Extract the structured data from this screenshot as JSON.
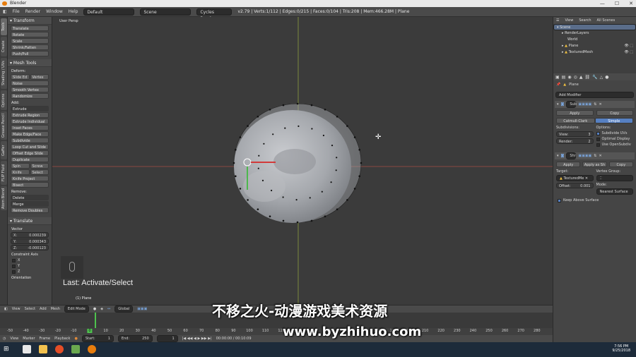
{
  "window": {
    "title": "Blender",
    "controls": [
      "—",
      "☐",
      "✕"
    ]
  },
  "menubar": {
    "menus": [
      "File",
      "Render",
      "Window",
      "Help"
    ],
    "screen_layout": "Default",
    "scene": "Scene",
    "engine": "Cycles Render",
    "stats": "v2.79 | Verts:1/112 | Edges:0/215 | Faces:0/104 | Tris:208 | Mem:466.28M | Plane"
  },
  "vertical_tabs": [
    "Tools",
    "Create",
    "Shading / UVs",
    "Options",
    "Grease Pencil",
    "Gaffer",
    "FLIP Fluid",
    "Atom Blend"
  ],
  "toolshelf": {
    "transform_header": "Transform",
    "transform_buttons": [
      "Translate",
      "Rotate",
      "Scale",
      "Shrink/Fatten",
      "Push/Pull"
    ],
    "mesh_tools_header": "Mesh Tools",
    "deform_label": "Deform:",
    "slide_edge": "Slide Ed",
    "vertex": "Vertex",
    "deform_buttons": [
      "Noise",
      "Smooth Vertex",
      "Randomize"
    ],
    "add_label": "Add:",
    "extrude_select": "Extrude",
    "add_buttons": [
      "Extrude Region",
      "Extrude Individual",
      "Inset Faces",
      "Make Edge/Face",
      "Subdivide",
      "Loop Cut and Slide",
      "Offset Edge Slide",
      "Duplicate"
    ],
    "spin": "Spin",
    "screw": "Screw",
    "knife": "Knife",
    "select": "Select",
    "knife_project": "Knife Project",
    "bisect": "Bisect",
    "remove_label": "Remove:",
    "delete": "Delete",
    "merge": "Merge",
    "remove_doubles": "Remove Doubles",
    "translate_header": "Translate",
    "vector_label": "Vector",
    "vector": [
      {
        "axis": "X:",
        "value": "0.000239"
      },
      {
        "axis": "Y:",
        "value": "0.000343"
      },
      {
        "axis": "Z:",
        "value": "-0.000123"
      }
    ],
    "constraint_label": "Constraint Axis",
    "constraints": [
      "X",
      "Y",
      "Z"
    ],
    "orientation_label": "Orientation"
  },
  "viewport": {
    "view_label": "User Persp",
    "last_operator": "Last: Activate/Select",
    "object_label": "(1) Plane"
  },
  "viewport_header": {
    "items": [
      "View",
      "Select",
      "Add",
      "Mesh"
    ],
    "mode": "Edit Mode",
    "orientation": "Global"
  },
  "timeline": {
    "ticks": [
      "-50",
      "-40",
      "-30",
      "-20",
      "-10",
      "0",
      "10",
      "20",
      "30",
      "40",
      "50",
      "60",
      "70",
      "80",
      "90",
      "100",
      "110",
      "120",
      "130",
      "140",
      "150",
      "160",
      "170",
      "180",
      "190",
      "200",
      "210",
      "220",
      "230",
      "240",
      "250",
      "260",
      "270",
      "280"
    ],
    "current_frame": "0",
    "header_items": [
      "View",
      "Marker",
      "Frame",
      "Playback"
    ],
    "start_label": "Start:",
    "start_value": "1",
    "end_label": "End:",
    "end_value": "250",
    "frame_value": "1",
    "time": "00:00:00 / 00:10:09"
  },
  "outliner": {
    "tabs": [
      "View",
      "Search",
      "All Scenes"
    ],
    "items": [
      "Scene",
      "RenderLayers",
      "World",
      "Plane",
      "TexturedMesh"
    ]
  },
  "properties": {
    "object_name": "Plane",
    "add_modifier": "Add Modifier",
    "mod1": {
      "name": "Sub",
      "apply": "Apply",
      "copy": "Copy",
      "type_a": "Catmull-Clark",
      "type_b": "Simple",
      "subdivisions_label": "Subdivisions:",
      "options_label": "Options:",
      "view_label": "View:",
      "view_value": "3",
      "render_label": "Render:",
      "render_value": "2",
      "opt_subdivide_uvs": "Subdivide UVs",
      "opt_optimal_display": "Optimal Display",
      "opt_opensubdiv": "Use OpenSubdiv"
    },
    "mod2": {
      "name": "Shr",
      "apply": "Apply",
      "apply_as": "Apply as Sh",
      "copy": "Copy",
      "target_label": "Target:",
      "vertex_group_label": "Vertex Group:",
      "target_value": "TexturedMe",
      "offset_label": "Offset:",
      "offset_value": "0.001",
      "mode_label": "Mode:",
      "mode_value": "Nearest Surface",
      "keep_above": "Keep Above Surface"
    }
  },
  "taskbar": {
    "time": "7:56 PM",
    "date": "9/25/2018"
  },
  "watermark": {
    "line1": "不移之火-动漫游戏美术资源",
    "line2": "www.byzhihuo.com"
  }
}
